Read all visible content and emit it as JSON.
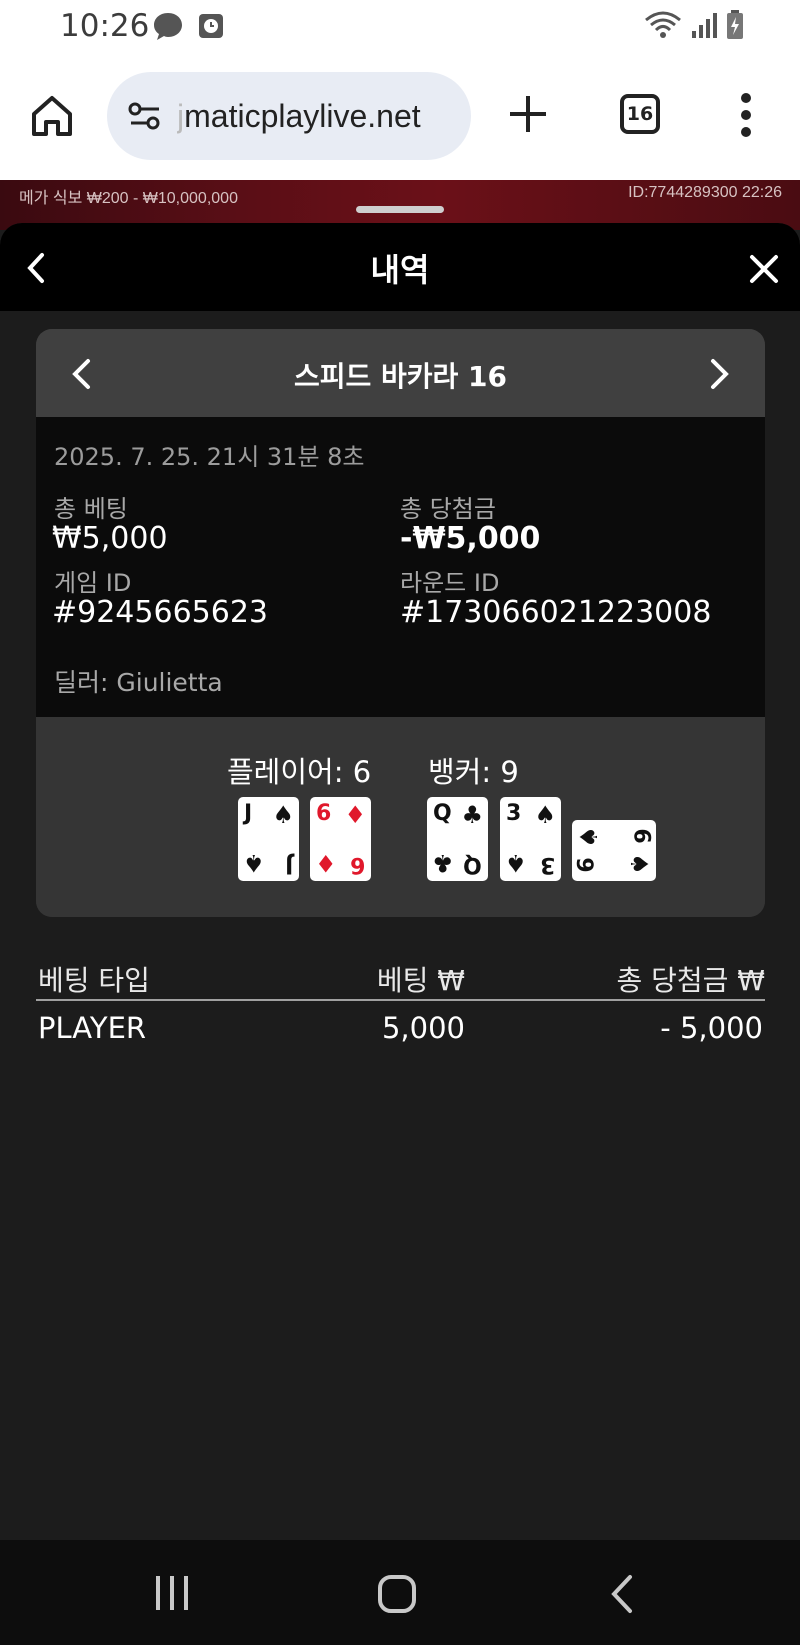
{
  "status_bar": {
    "time": "10:26"
  },
  "browser": {
    "url_prefix": "j",
    "url": "maticplaylive.net",
    "tab_count": "16"
  },
  "game_strip": {
    "left_text": "메가 식보  ₩200 - ₩10,000,000",
    "right_text": "ID:7744289300  22:26"
  },
  "modal": {
    "title": "내역",
    "game_title": "스피드 바카라 16",
    "date": "2025. 7. 25. 21시 31분 8초",
    "total_bet_label": "총 베팅",
    "total_bet_value": "₩5,000",
    "total_win_label": "총 당첨금",
    "total_win_value": "-₩5,000",
    "game_id_label": "게임 ID",
    "game_id_value": "#9245665623",
    "round_id_label": "라운드 ID",
    "round_id_value": "#173066021223008",
    "dealer": "딜러: Giulietta",
    "player_label": "플레이어: 6",
    "banker_label": "뱅커: 9",
    "player_cards": [
      {
        "rank": "J",
        "suit": "♠",
        "color": "black"
      },
      {
        "rank": "6",
        "suit": "♦",
        "color": "red"
      }
    ],
    "banker_cards": [
      {
        "rank": "Q",
        "suit": "♣",
        "color": "black"
      },
      {
        "rank": "3",
        "suit": "♠",
        "color": "black"
      },
      {
        "rank": "6",
        "suit": "♠",
        "color": "black",
        "rotated": true
      }
    ]
  },
  "bet_table": {
    "headers": [
      "베팅 타입",
      "베팅 ₩",
      "총 당첨금 ₩"
    ],
    "rows": [
      {
        "type": "PLAYER",
        "bet": "5,000",
        "win": "- 5,000"
      }
    ]
  },
  "colors": {
    "background": "#1c1c1c",
    "red_suit": "#e0182b",
    "game_strip": "#5a0e16"
  },
  "icons": {
    "home": "home-icon",
    "site_settings": "tune-icon",
    "new_tab": "plus-icon",
    "menu": "more-vert-icon",
    "back": "chevron-left-icon",
    "close": "close-icon"
  }
}
